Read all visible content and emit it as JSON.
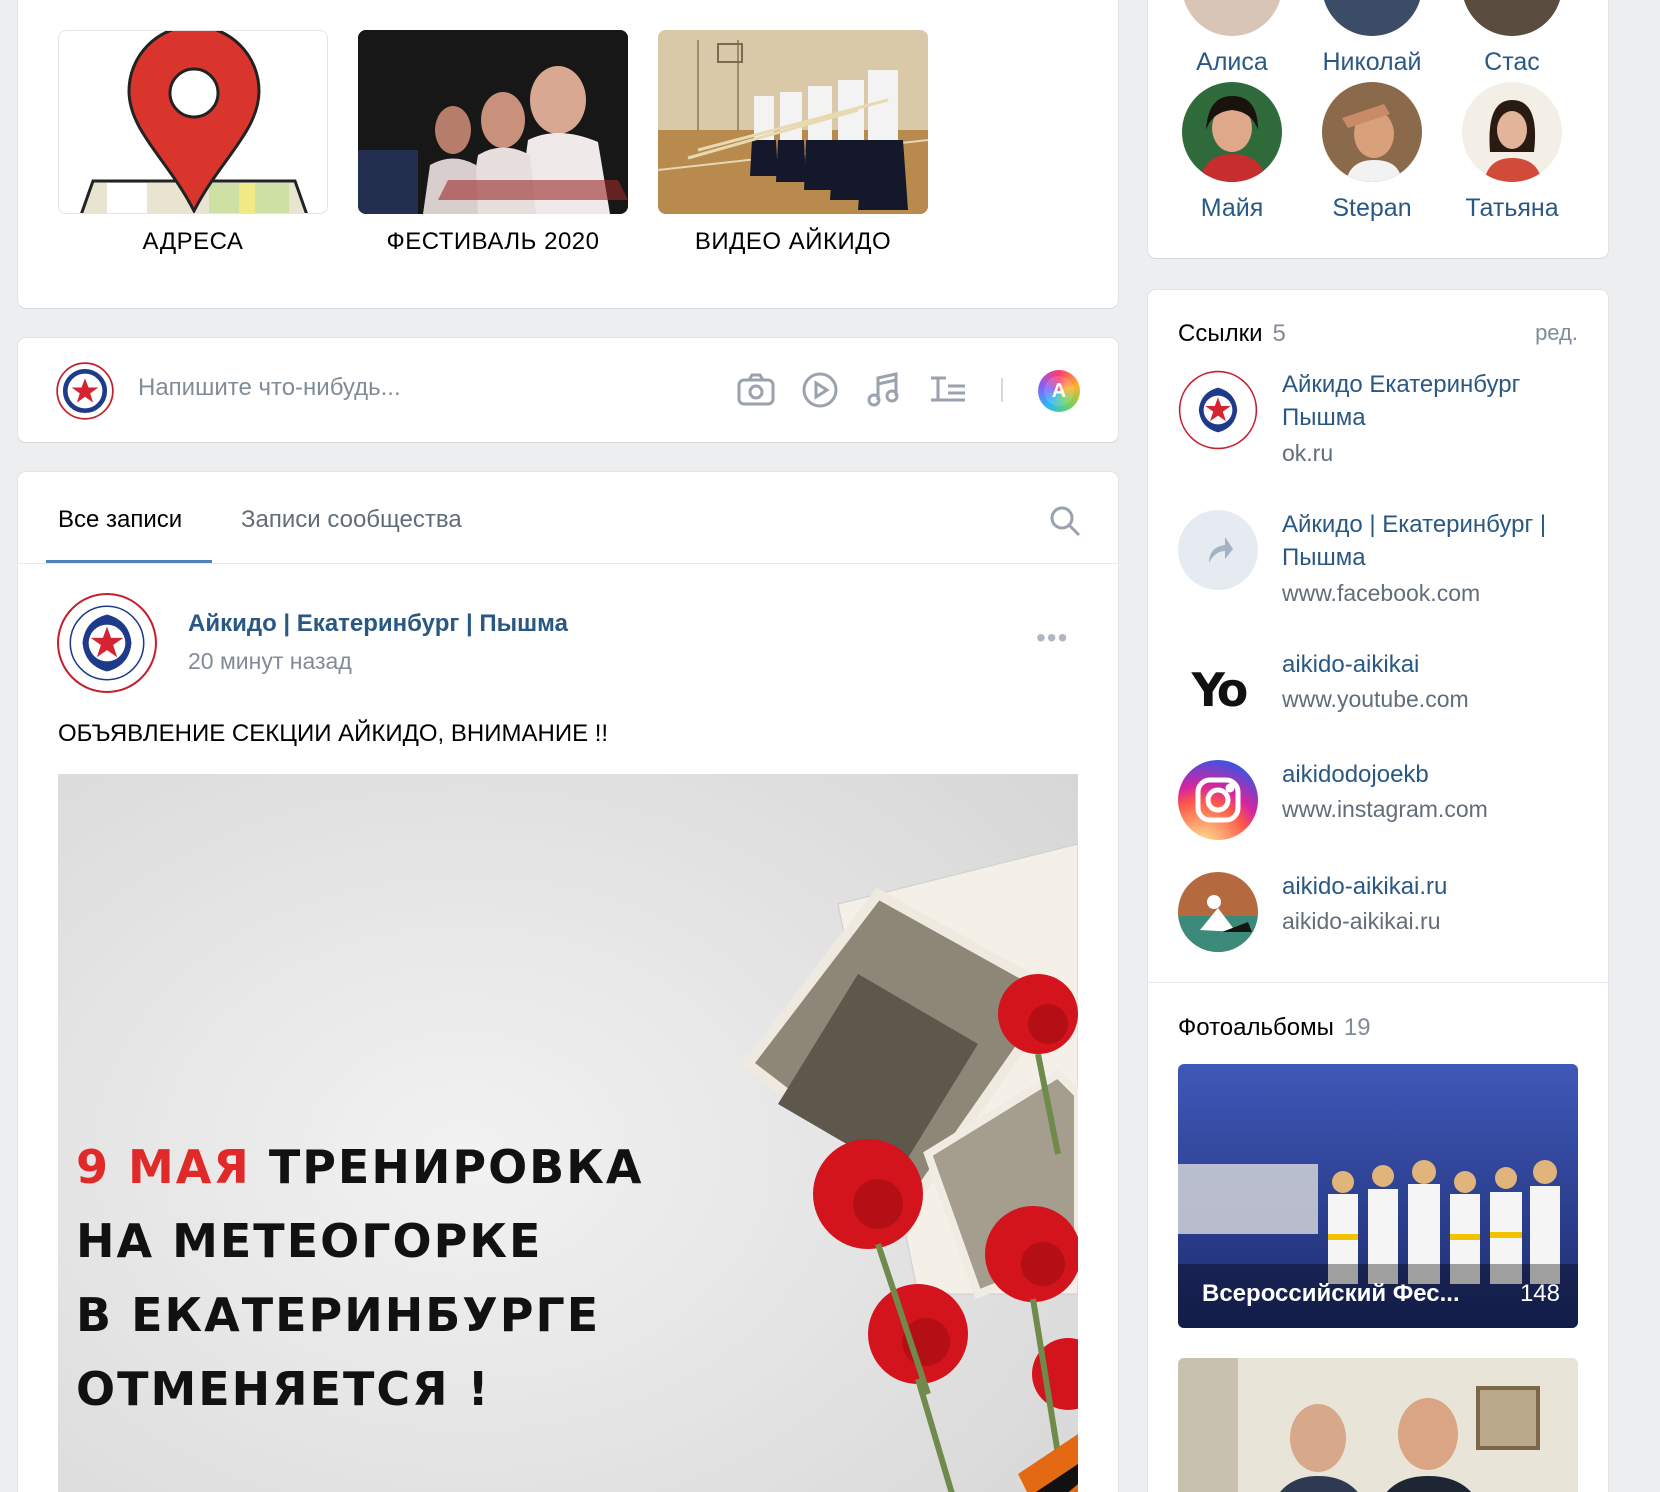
{
  "top_links": {
    "tiles": [
      {
        "caption": "АДРЕСА"
      },
      {
        "caption": "ФЕСТИВАЛЬ 2020"
      },
      {
        "caption": "ВИДЕО АЙКИДО"
      }
    ]
  },
  "composer": {
    "placeholder": "Напишите что-нибудь...",
    "poster_badge": "A"
  },
  "feed": {
    "tabs": [
      {
        "label": "Все записи"
      },
      {
        "label": "Записи сообщества"
      }
    ],
    "post": {
      "author": "Айкидо | Екатеринбург | Пышма",
      "time": "20 минут назад",
      "more": "•••",
      "text": "ОБЪЯВЛЕНИЕ СЕКЦИИ АЙКИДО, ВНИМАНИЕ !!",
      "image_text": {
        "line1_red": "9 МАЯ",
        "line1_black": "ТРЕНИРОВКА",
        "line2": "НА МЕТЕОГОРКЕ",
        "line3": "В ЕКАТЕРИНБУРГЕ",
        "line4": "ОТМЕНЯЕТСЯ !"
      }
    }
  },
  "friends": [
    {
      "name": "Алиса"
    },
    {
      "name": "Николай"
    },
    {
      "name": "Стас"
    },
    {
      "name": "Майя"
    },
    {
      "name": "Stepan"
    },
    {
      "name": "Татьяна"
    }
  ],
  "links": {
    "title": "Ссылки",
    "count": "5",
    "edit": "ред.",
    "items": [
      {
        "title": "Айкидо Екатеринбург Пышма",
        "url": "ok.ru"
      },
      {
        "title": "Айкидо | Екатеринбург | Пышма",
        "url": "www.facebook.com"
      },
      {
        "title": "aikido-aikikai",
        "url": "www.youtube.com"
      },
      {
        "title": "aikidodojoekb",
        "url": "www.instagram.com"
      },
      {
        "title": "aikido-aikikai.ru",
        "url": "aikido-aikikai.ru"
      }
    ]
  },
  "albums": {
    "title": "Фотоальбомы",
    "count": "19",
    "items": [
      {
        "caption": "Всероссийский Фес...",
        "count": "148"
      },
      {
        "caption": "",
        "count": ""
      }
    ]
  },
  "colors": {
    "link": "#2a5885",
    "accent_blue": "#5181b8",
    "muted": "#818c99",
    "red_text": "#e02a2a"
  }
}
